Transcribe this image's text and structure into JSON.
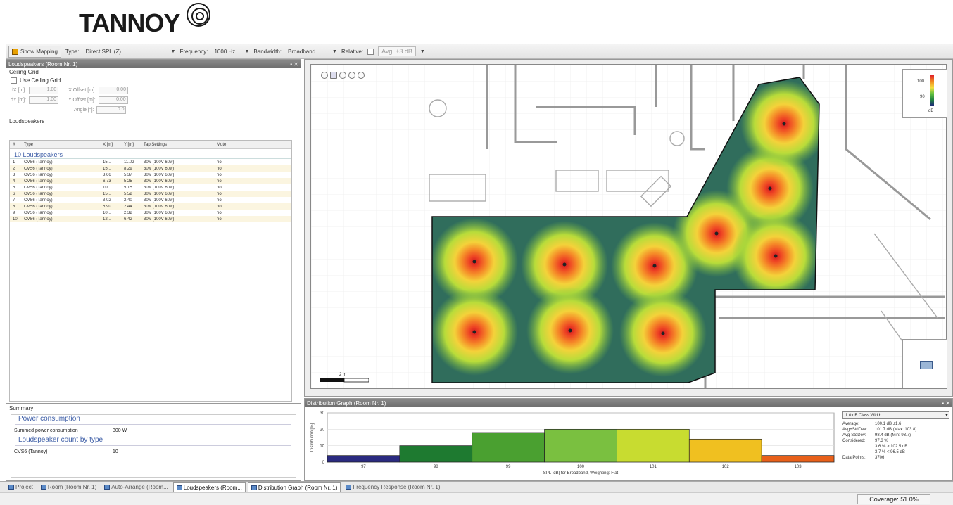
{
  "app": {
    "logo": "TANNOY",
    "logo_mark": "target-ring-logo"
  },
  "toolbar": {
    "show_mapping": "Show Mapping",
    "type_label": "Type:",
    "type_value": "Direct SPL (Z)",
    "frequency_label": "Frequency:",
    "frequency_value": "1000 Hz",
    "bandwidth_label": "Bandwidth:",
    "bandwidth_value": "Broadband",
    "relative_label": "Relative:",
    "avg_placeholder": "Avg. ±3 dB"
  },
  "left_panel": {
    "title": "Loudspeakers (Room Nr. 1)",
    "ceiling_grid_label": "Ceiling Grid",
    "use_ceiling_grid": "Use Ceiling Grid",
    "dx_label": "dX [m]:",
    "dx_value": "1.00",
    "dy_label": "dY [m]:",
    "dy_value": "1.00",
    "xoffset_label": "X Offset [m]:",
    "xoffset_value": "0.00",
    "yoffset_label": "Y Offset [m]:",
    "yoffset_value": "0.00",
    "angle_label": "Angle [°]:",
    "angle_value": "0.0",
    "loudspeakers_label": "Loudspeakers",
    "columns": [
      "#",
      "Type",
      "X [m]",
      "Y [m]",
      "Tap Settings",
      "Mute"
    ],
    "group_title": "10 Loudspeakers",
    "rows": [
      [
        "1",
        "CVS6 (Tannoy)",
        "15...",
        "11.02",
        "30w (100V 60w)",
        "no"
      ],
      [
        "2",
        "CVS6 (Tannoy)",
        "15...",
        "8.29",
        "30w (100V 60w)",
        "no"
      ],
      [
        "3",
        "CVS6 (Tannoy)",
        "3.66",
        "5.37",
        "30w (100V 60w)",
        "no"
      ],
      [
        "4",
        "CVS6 (Tannoy)",
        "6.73",
        "5.25",
        "30w (100V 60w)",
        "no"
      ],
      [
        "5",
        "CVS6 (Tannoy)",
        "10...",
        "5.15",
        "30w (100V 60w)",
        "no"
      ],
      [
        "6",
        "CVS6 (Tannoy)",
        "15...",
        "5.52",
        "30w (100V 60w)",
        "no"
      ],
      [
        "7",
        "CVS6 (Tannoy)",
        "3.02",
        "2.40",
        "30w (100V 60w)",
        "no"
      ],
      [
        "8",
        "CVS6 (Tannoy)",
        "6.90",
        "2.44",
        "30w (100V 60w)",
        "no"
      ],
      [
        "9",
        "CVS6 (Tannoy)",
        "10...",
        "2.32",
        "30w (100V 60w)",
        "no"
      ],
      [
        "10",
        "CVS6 (Tannoy)",
        "12...",
        "6.42",
        "30w (100V 60w)",
        "no"
      ]
    ]
  },
  "summary": {
    "title": "Summary:",
    "power_heading": "Power consumption",
    "power_key": "Summed power consumption",
    "power_value": "300 W",
    "count_heading": "Loudspeaker count by type",
    "count_key": "CVS6 (Tannoy)",
    "count_value": "10"
  },
  "map": {
    "scale_label": "2 m",
    "legend_high": "100",
    "legend_low": "90",
    "legend_unit": "dB",
    "colors": {
      "low": "#202080",
      "mid": "#60c040",
      "high": "#e0202a"
    }
  },
  "distribution": {
    "title": "Distribution Graph (Room Nr. 1)",
    "class_width": "1.0 dB Class Width",
    "stats": [
      [
        "Average:",
        "100.1 dB ±1.6"
      ],
      [
        "Avg+StdDev:",
        "101.7 dB (Max: 103.8)"
      ],
      [
        "Avg-StdDev:",
        "98.4 dB (Min: 93.7)"
      ],
      [
        "Considered:",
        "97.3 %"
      ],
      [
        "",
        "3.6 % > 102.5 dB"
      ],
      [
        "",
        "3.7 % < 96.5 dB"
      ],
      [
        "Data Points:",
        "3706"
      ]
    ]
  },
  "chart_data": {
    "type": "bar",
    "categories": [
      "97",
      "98",
      "99",
      "100",
      "101",
      "102",
      "103"
    ],
    "values": [
      4,
      10,
      18,
      20,
      20,
      14,
      4
    ],
    "colors": [
      "#2a2a80",
      "#1e7a30",
      "#4aa030",
      "#7ac040",
      "#c8dc30",
      "#f0c020",
      "#e8601a"
    ],
    "xlabel": "SPL [dB] for Broadband, Weighting: Flat",
    "ylabel": "Distribution [%]",
    "yticks": [
      "0",
      "10",
      "20",
      "30"
    ],
    "ylim": [
      0,
      30
    ],
    "grid": true
  },
  "tabs": [
    {
      "label": "Project",
      "active": false
    },
    {
      "label": "Room (Room Nr. 1)",
      "active": false
    },
    {
      "label": "Auto-Arrange (Room...",
      "active": false
    },
    {
      "label": "Loudspeakers (Room...",
      "active": true
    },
    {
      "label": "Distribution Graph (Room Nr. 1)",
      "active": true
    },
    {
      "label": "Frequency Response (Room Nr. 1)",
      "active": false
    }
  ],
  "status": {
    "coverage": "Coverage: 51.0%"
  }
}
